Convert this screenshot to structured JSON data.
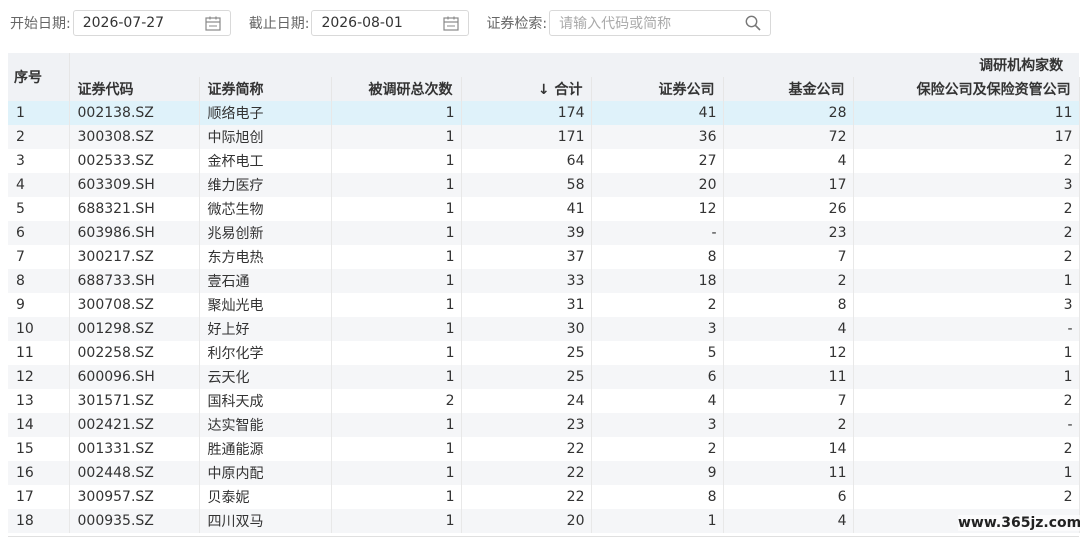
{
  "filters": {
    "start_label": "开始日期:",
    "start_value": "2026-07-27",
    "end_label": "截止日期:",
    "end_value": "2026-08-01",
    "search_label": "证券检索:",
    "search_placeholder": "请输入代码或简称"
  },
  "table": {
    "seq_header": "序号",
    "group_header": "调研机构家数",
    "columns": [
      "证券代码",
      "证券简称",
      "被调研总次数",
      "↓ 合计",
      "证券公司",
      "基金公司",
      "保险公司及保险资管公司"
    ],
    "rows": [
      {
        "seq": "1",
        "code": "002138.SZ",
        "name": "顺络电子",
        "times": "1",
        "total": "174",
        "securities": "41",
        "funds": "28",
        "insurance": "11"
      },
      {
        "seq": "2",
        "code": "300308.SZ",
        "name": "中际旭创",
        "times": "1",
        "total": "171",
        "securities": "36",
        "funds": "72",
        "insurance": "17"
      },
      {
        "seq": "3",
        "code": "002533.SZ",
        "name": "金杯电工",
        "times": "1",
        "total": "64",
        "securities": "27",
        "funds": "4",
        "insurance": "2"
      },
      {
        "seq": "4",
        "code": "603309.SH",
        "name": "维力医疗",
        "times": "1",
        "total": "58",
        "securities": "20",
        "funds": "17",
        "insurance": "3"
      },
      {
        "seq": "5",
        "code": "688321.SH",
        "name": "微芯生物",
        "times": "1",
        "total": "41",
        "securities": "12",
        "funds": "26",
        "insurance": "2"
      },
      {
        "seq": "6",
        "code": "603986.SH",
        "name": "兆易创新",
        "times": "1",
        "total": "39",
        "securities": "-",
        "funds": "23",
        "insurance": "2"
      },
      {
        "seq": "7",
        "code": "300217.SZ",
        "name": "东方电热",
        "times": "1",
        "total": "37",
        "securities": "8",
        "funds": "7",
        "insurance": "2"
      },
      {
        "seq": "8",
        "code": "688733.SH",
        "name": "壹石通",
        "times": "1",
        "total": "33",
        "securities": "18",
        "funds": "2",
        "insurance": "1"
      },
      {
        "seq": "9",
        "code": "300708.SZ",
        "name": "聚灿光电",
        "times": "1",
        "total": "31",
        "securities": "2",
        "funds": "8",
        "insurance": "3"
      },
      {
        "seq": "10",
        "code": "001298.SZ",
        "name": "好上好",
        "times": "1",
        "total": "30",
        "securities": "3",
        "funds": "4",
        "insurance": "-"
      },
      {
        "seq": "11",
        "code": "002258.SZ",
        "name": "利尔化学",
        "times": "1",
        "total": "25",
        "securities": "5",
        "funds": "12",
        "insurance": "1"
      },
      {
        "seq": "12",
        "code": "600096.SH",
        "name": "云天化",
        "times": "1",
        "total": "25",
        "securities": "6",
        "funds": "11",
        "insurance": "1"
      },
      {
        "seq": "13",
        "code": "301571.SZ",
        "name": "国科天成",
        "times": "2",
        "total": "24",
        "securities": "4",
        "funds": "7",
        "insurance": "2"
      },
      {
        "seq": "14",
        "code": "002421.SZ",
        "name": "达实智能",
        "times": "1",
        "total": "23",
        "securities": "3",
        "funds": "2",
        "insurance": "-"
      },
      {
        "seq": "15",
        "code": "001331.SZ",
        "name": "胜通能源",
        "times": "1",
        "total": "22",
        "securities": "2",
        "funds": "14",
        "insurance": "2"
      },
      {
        "seq": "16",
        "code": "002448.SZ",
        "name": "中原内配",
        "times": "1",
        "total": "22",
        "securities": "9",
        "funds": "11",
        "insurance": "1"
      },
      {
        "seq": "17",
        "code": "300957.SZ",
        "name": "贝泰妮",
        "times": "1",
        "total": "22",
        "securities": "8",
        "funds": "6",
        "insurance": "2"
      },
      {
        "seq": "18",
        "code": "000935.SZ",
        "name": "四川双马",
        "times": "1",
        "total": "20",
        "securities": "1",
        "funds": "4",
        "insurance": ""
      }
    ]
  },
  "watermark": "www.365jz.com",
  "colors": {
    "selected_row": "#dff2fa",
    "header_bg": "#f0f2f5",
    "stripe": "#f5f6f8"
  },
  "icons": {
    "date": "calendar-icon",
    "search": "search-icon"
  }
}
